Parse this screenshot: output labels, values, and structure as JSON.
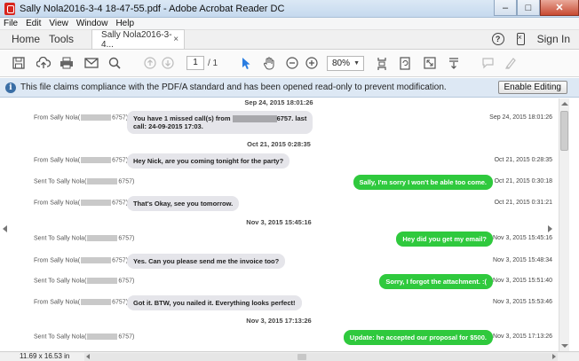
{
  "window": {
    "title": "Sally Nola2016-3-4 18-47-55.pdf - Adobe Acrobat Reader DC",
    "minimize": "–",
    "maximize": "□",
    "close": "✕"
  },
  "menu": [
    "File",
    "Edit",
    "View",
    "Window",
    "Help"
  ],
  "nav": {
    "home": "Home",
    "tools": "Tools",
    "doc_tab": "Sally Nola2016-3-4...",
    "tab_close": "×",
    "help": "?",
    "sign_in": "Sign In"
  },
  "toolbar": {
    "page_current": "1",
    "page_total": "/ 1",
    "zoom": "80%"
  },
  "infobar": {
    "message": "This file claims compliance with the PDF/A standard and has been opened read-only to prevent modification.",
    "button": "Enable Editing"
  },
  "conversation": {
    "dates": [
      "Sep 24, 2015 18:01:26",
      "Oct 21, 2015 0:28:35",
      "Nov 3, 2015 15:45:16",
      "Nov 3, 2015 17:13:26"
    ],
    "messages": [
      {
        "sender_prefix": "From Sally Nola(",
        "sender_suffix": "6757)",
        "text_before": "You have 1 missed call(s) from",
        "text_after": "6757. last",
        "text_line2": "call: 24-09-2015 17:03.",
        "time": "Sep 24, 2015 18:01:26"
      },
      {
        "sender_prefix": "From Sally Nola(",
        "sender_suffix": "6757)",
        "text": "Hey Nick,  are you coming tonight for the party?",
        "time": "Oct 21, 2015 0:28:35"
      },
      {
        "sender_prefix": "Sent To Sally Nola(",
        "sender_suffix": "6757)",
        "text": "Sally, I'm sorry I won't be able too come.",
        "time": "Oct 21, 2015 0:30:18"
      },
      {
        "sender_prefix": "From Sally Nola(",
        "sender_suffix": "6757)",
        "text": "That's Okay, see you tomorrow.",
        "time": "Oct 21, 2015 0:31:21"
      },
      {
        "sender_prefix": "Sent To Sally Nola(",
        "sender_suffix": "6757)",
        "text": "Hey did you get my email?",
        "time": "Nov 3, 2015 15:45:16"
      },
      {
        "sender_prefix": "From Sally Nola(",
        "sender_suffix": "6757)",
        "text": "Yes. Can you please send me the invoice too?",
        "time": "Nov 3, 2015 15:48:34"
      },
      {
        "sender_prefix": "Sent To Sally Nola(",
        "sender_suffix": "6757)",
        "text": "Sorry, I forgot the attachment. :(",
        "time": "Nov 3, 2015 15:51:40"
      },
      {
        "sender_prefix": "From Sally Nola(",
        "sender_suffix": "6757)",
        "text": "Got it. BTW, you nailed it. Everything looks perfect!",
        "time": "Nov 3, 2015 15:53:46"
      },
      {
        "sender_prefix": "Sent To Sally Nola(",
        "sender_suffix": "6757)",
        "text": "Update: he accepted our proposal for $500.",
        "time": "Nov 3, 2015 17:13:26"
      }
    ]
  },
  "status": {
    "page_size": "11.69 x 16.53 in"
  },
  "colors": {
    "sent_bubble": "#2fc93d",
    "received_bubble": "#e5e5ea",
    "info_bar": "#dde8f4"
  }
}
